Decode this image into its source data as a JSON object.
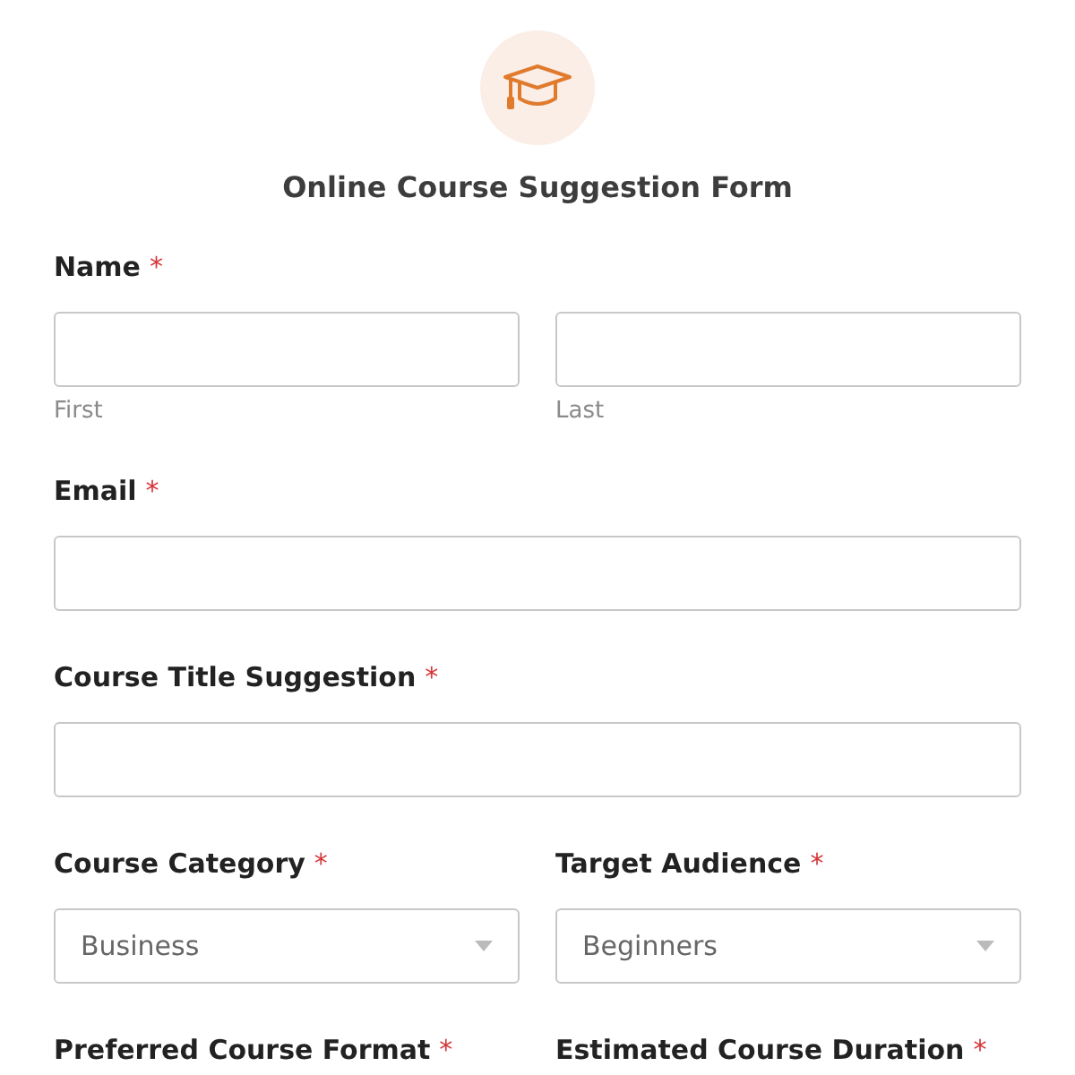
{
  "form": {
    "title": "Online Course Suggestion Form"
  },
  "rows": [
    {
      "label": "Name",
      "mark": "*",
      "kind": "name",
      "parts": [
        {
          "sublabel": "First"
        },
        {
          "sublabel": "Last"
        }
      ]
    },
    {
      "label": "Email",
      "mark": "*",
      "kind": "text"
    },
    {
      "label": "Course Title Suggestion",
      "mark": "*",
      "kind": "text"
    },
    {
      "kind": "pair",
      "fields": [
        {
          "label": "Course Category",
          "mark": "*",
          "kind": "select",
          "value": "Business"
        },
        {
          "label": "Target Audience",
          "mark": "*",
          "kind": "select",
          "value": "Beginners"
        }
      ]
    },
    {
      "kind": "pair",
      "fields": [
        {
          "label": "Preferred Course Format",
          "mark": "*",
          "kind": "label"
        },
        {
          "label": "Estimated Course Duration",
          "mark": "*",
          "kind": "label"
        }
      ]
    }
  ]
}
